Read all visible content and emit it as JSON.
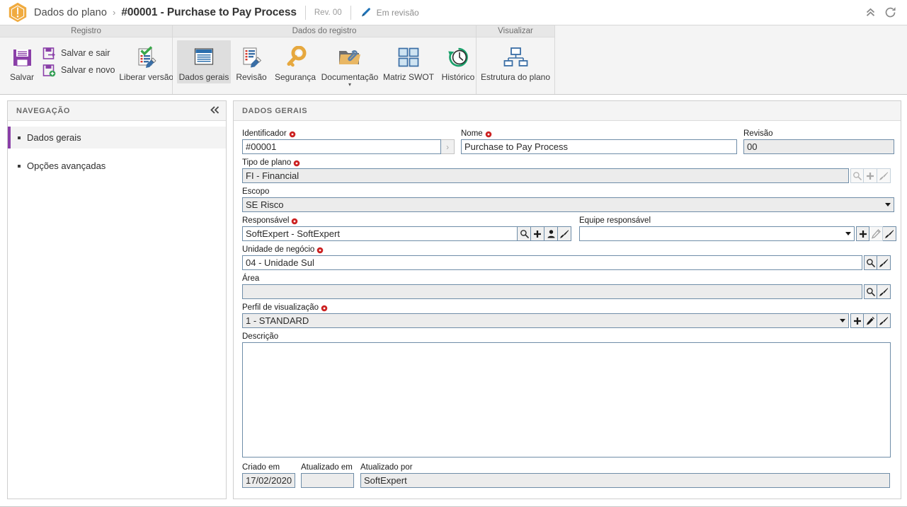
{
  "titlebar": {
    "breadcrumb_root": "Dados do plano",
    "separator": "›",
    "title": "#00001 - Purchase to Pay Process",
    "revision": "Rev. 00",
    "status": "Em revisão",
    "collapse_icon": "chevron-double-up-icon",
    "refresh_icon": "refresh-icon",
    "warning_icon": "warning-hexagon-icon",
    "pen_icon": "pen-icon"
  },
  "ribbon": {
    "groups": [
      {
        "title": "Registro",
        "buttons": [
          {
            "label": "Salvar",
            "icon": "floppy-disk-icon",
            "style": "large",
            "active": false
          },
          {
            "label": "Salvar e sair",
            "icon": "save-exit-icon",
            "style": "stacked",
            "active": false
          },
          {
            "label": "Salvar e novo",
            "icon": "save-new-icon",
            "style": "stacked",
            "active": false
          },
          {
            "label": "Liberar versão",
            "icon": "release-version-icon",
            "style": "large",
            "active": false
          }
        ]
      },
      {
        "title": "Dados do registro",
        "buttons": [
          {
            "label": "Dados gerais",
            "icon": "general-data-icon",
            "style": "large",
            "active": true
          },
          {
            "label": "Revisão",
            "icon": "revision-icon",
            "style": "large",
            "active": false
          },
          {
            "label": "Segurança",
            "icon": "key-icon",
            "style": "large",
            "active": false
          },
          {
            "label": "Documentação",
            "icon": "folder-attachment-icon",
            "style": "large",
            "active": false,
            "caret": "▾"
          },
          {
            "label": "Matriz SWOT",
            "icon": "swot-matrix-icon",
            "style": "large",
            "active": false
          },
          {
            "label": "Histórico",
            "icon": "history-clock-icon",
            "style": "large",
            "active": false
          }
        ]
      },
      {
        "title": "Visualizar",
        "buttons": [
          {
            "label": "Estrutura do plano",
            "icon": "org-structure-icon",
            "style": "large",
            "active": false
          }
        ]
      }
    ]
  },
  "navigation": {
    "header": "NAVEGAÇÃO",
    "collapse_icon": "chevron-double-left-icon",
    "items": [
      {
        "label": "Dados gerais",
        "selected": true
      },
      {
        "label": "Opções avançadas",
        "selected": false
      }
    ]
  },
  "form": {
    "header": "DADOS GERAIS",
    "fields": {
      "identificador": {
        "label": "Identificador",
        "required": true,
        "value": "#00001"
      },
      "nome": {
        "label": "Nome",
        "required": true,
        "value": "Purchase to Pay Process"
      },
      "revisao": {
        "label": "Revisão",
        "required": false,
        "value": "00"
      },
      "tipo_de_plano": {
        "label": "Tipo de plano",
        "required": true,
        "value": "FI - Financial"
      },
      "escopo": {
        "label": "Escopo",
        "required": false,
        "value": "SE Risco"
      },
      "responsavel": {
        "label": "Responsável",
        "required": true,
        "value": "SoftExpert - SoftExpert"
      },
      "equipe_responsavel": {
        "label": "Equipe responsável",
        "required": false,
        "value": ""
      },
      "unidade_de_negocio": {
        "label": "Unidade de negócio",
        "required": true,
        "value": "04 - Unidade Sul"
      },
      "area": {
        "label": "Área",
        "required": false,
        "value": ""
      },
      "perfil_de_visualizacao": {
        "label": "Perfil de visualização",
        "required": true,
        "value": "1 - STANDARD"
      },
      "descricao": {
        "label": "Descrição",
        "required": false,
        "value": ""
      },
      "criado_em": {
        "label": "Criado em",
        "required": false,
        "value": "17/02/2020"
      },
      "atualizado_em": {
        "label": "Atualizado em",
        "required": false,
        "value": ""
      },
      "atualizado_por": {
        "label": "Atualizado por",
        "required": false,
        "value": "SoftExpert"
      }
    },
    "icons": {
      "search": "search-icon",
      "add": "plus-icon",
      "user": "user-icon",
      "brush": "brush-icon",
      "edit": "pencil-icon",
      "expand": "chevron-right-icon"
    }
  },
  "colors": {
    "accent_purple": "#8a3fa8",
    "brand_orange": "#f0ab40",
    "required_red": "#cc2222",
    "field_border": "#6f8da8",
    "readonly_bg": "#ececec"
  }
}
